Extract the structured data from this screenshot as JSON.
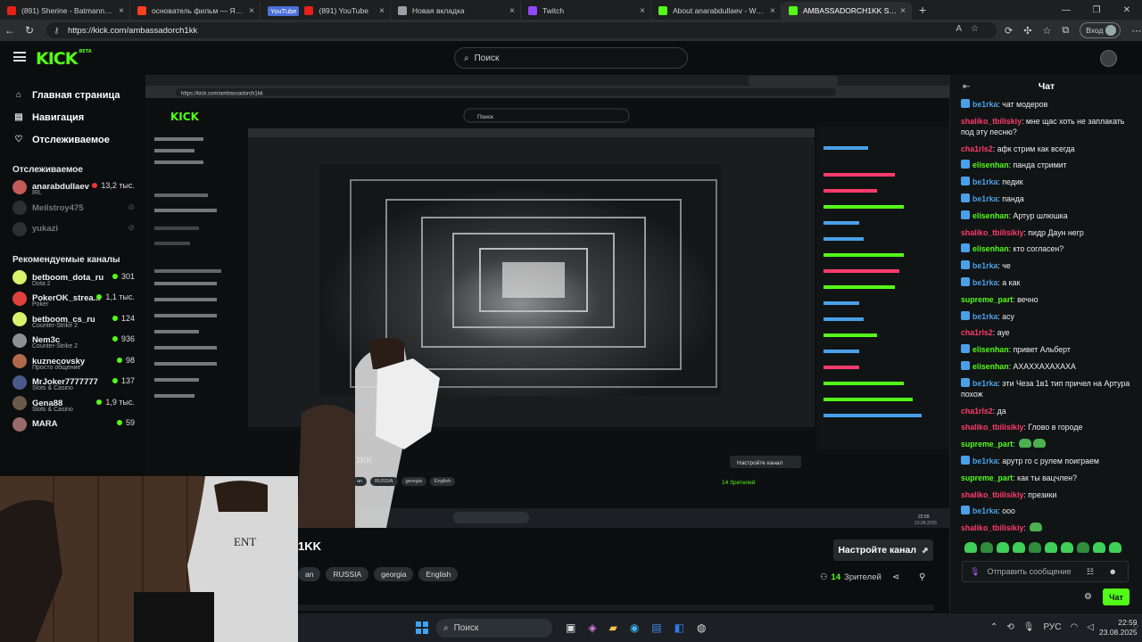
{
  "browser": {
    "tabs": [
      {
        "label": "(891) Sherine - Batmanna Ansak",
        "icon": "youtube-icon",
        "color": "#e62117"
      },
      {
        "label": "основатель фильм — Яндекс: на",
        "icon": "yandex-icon",
        "color": "#fc3f1d"
      },
      {
        "label": "(891) YouTube",
        "icon": "youtube-icon",
        "color": "#e62117",
        "badge": "YouTube"
      },
      {
        "label": "Новая вкладка",
        "icon": "newtab-icon",
        "color": "#9aa0a6"
      },
      {
        "label": "Twitch",
        "icon": "twitch-icon",
        "color": "#9146ff"
      },
      {
        "label": "About anarabdullaev - Watch Liv",
        "icon": "kick-icon",
        "color": "#53fc18"
      },
      {
        "label": "AMBASSADORCH1KK Stream - W",
        "icon": "kick-icon",
        "color": "#53fc18",
        "active": true
      }
    ],
    "url": "https://kick.com/ambassadorch1kk",
    "login_label": "Вход"
  },
  "kick": {
    "logo": "KICK",
    "logo_beta": "BETA",
    "search_placeholder": "Поиск"
  },
  "sidebar": {
    "nav": [
      {
        "label": "Главная страница",
        "icon": "home-icon"
      },
      {
        "label": "Навигация",
        "icon": "compass-icon"
      },
      {
        "label": "Отслеживаемое",
        "icon": "heart-icon"
      }
    ],
    "following_title": "Отслеживаемое",
    "following": [
      {
        "name": "anarabdullaev",
        "category": "IRL",
        "viewers": "13,2 тыс.",
        "live": true,
        "color": "#c45a5a"
      },
      {
        "name": "Meilstroy475",
        "category": "",
        "viewers": "",
        "live": false
      },
      {
        "name": "yukazi",
        "category": "",
        "viewers": "",
        "live": false
      }
    ],
    "recommended_title": "Рекомендуемые каналы",
    "recommended": [
      {
        "name": "betboom_dota_ru",
        "category": "Dota 2",
        "viewers": "301",
        "color": "#d9f26b"
      },
      {
        "name": "PokerOK_strea...",
        "category": "Poker",
        "viewers": "1,1 тыс.",
        "color": "#e0413b"
      },
      {
        "name": "betboom_cs_ru",
        "category": "Counter-Strike 2",
        "viewers": "124",
        "color": "#d9f26b"
      },
      {
        "name": "Nem3c",
        "category": "Counter-Strike 2",
        "viewers": "936",
        "color": "#8f8f8f"
      },
      {
        "name": "kuznecovsky",
        "category": "Просто общение",
        "viewers": "98",
        "color": "#b06a4a"
      },
      {
        "name": "MrJoker7777777",
        "category": "Slots & Casino",
        "viewers": "137",
        "color": "#4a5a8a"
      },
      {
        "name": "Gena88",
        "category": "Slots & Casino",
        "viewers": "1,9 тыс.",
        "color": "#6a5a4a"
      },
      {
        "name": "MARA",
        "category": "",
        "viewers": "59",
        "color": "#9a6a6a"
      }
    ]
  },
  "stream": {
    "channel_title": "1KK",
    "tags": [
      "an",
      "RUSSIA",
      "georgia",
      "English"
    ],
    "setup_button": "Настройте канал",
    "viewers_count": "14",
    "viewers_label": "Зрителей",
    "inner_channel_title": "1KK",
    "inner_tags": [
      "an",
      "RUSSIA",
      "georgia",
      "English"
    ],
    "inner_setup_button": "Настройте канал",
    "inner_viewers": "14 Зрителей",
    "inner_search": "Поиск",
    "inner_time": "22:59",
    "inner_date": "23.08.2025"
  },
  "chat": {
    "title": "Чат",
    "messages": [
      {
        "user": "be1rka",
        "text": "чат модеров",
        "color": "#4aa0e8",
        "icon": true
      },
      {
        "user": "shaliko_tbiliskiy",
        "text": "мне щас хоть не заплакать под эту песню?",
        "color": "#ff3b6b"
      },
      {
        "user": "cha1rls2",
        "text": "афк стрим как всегда",
        "color": "#ff3b6b"
      },
      {
        "user": "elisenhan",
        "text": "панда стримит",
        "color": "#53fc18",
        "icon": true
      },
      {
        "user": "be1rka",
        "text": "педик",
        "color": "#4aa0e8",
        "icon": true
      },
      {
        "user": "be1rka",
        "text": "панда",
        "color": "#4aa0e8",
        "icon": true
      },
      {
        "user": "elisenhan",
        "text": "Артур шлюшка",
        "color": "#53fc18",
        "icon": true
      },
      {
        "user": "shaliko_tbilisikiy",
        "text": "пидр Даун негр",
        "color": "#ff3b6b"
      },
      {
        "user": "elisenhan",
        "text": "кто согласен?",
        "color": "#53fc18",
        "icon": true
      },
      {
        "user": "be1rka",
        "text": "че",
        "color": "#4aa0e8",
        "icon": true
      },
      {
        "user": "be1rka",
        "text": "а как",
        "color": "#4aa0e8",
        "icon": true
      },
      {
        "user": "supreme_part",
        "text": "вечно",
        "color": "#53fc18"
      },
      {
        "user": "be1rka",
        "text": "асу",
        "color": "#4aa0e8",
        "icon": true
      },
      {
        "user": "cha1rls2",
        "text": "ауе",
        "color": "#ff3b6b"
      },
      {
        "user": "elisenhan",
        "text": "привет Альберт",
        "color": "#53fc18",
        "icon": true
      },
      {
        "user": "elisenhan",
        "text": "АХАХХАХАХАХА",
        "color": "#53fc18",
        "icon": true
      },
      {
        "user": "be1rka",
        "text": "эти Чеза 1в1 тип причел на Артура похож",
        "color": "#4aa0e8",
        "icon": true
      },
      {
        "user": "cha1rls2",
        "text": "да",
        "color": "#ff3b6b"
      },
      {
        "user": "shaliko_tbilisikiy",
        "text": "Гловo в городе",
        "color": "#ff3b6b"
      },
      {
        "user": "supreme_part",
        "text": "",
        "color": "#53fc18",
        "emotes": 2
      },
      {
        "user": "be1rka",
        "text": "арутр го с рулем поиграем",
        "color": "#4aa0e8",
        "icon": true
      },
      {
        "user": "supreme_part",
        "text": "как ты вацчлен?",
        "color": "#53fc18"
      },
      {
        "user": "shaliko_tbilisikiy",
        "text": "презики",
        "color": "#ff3b6b"
      },
      {
        "user": "be1rka",
        "text": "ооо",
        "color": "#4aa0e8",
        "icon": true
      },
      {
        "user": "shaliko_tbilisikiy",
        "text": "",
        "color": "#ff3b6b",
        "emotes": 1
      }
    ],
    "input_placeholder": "Отправить сообщение",
    "send_label": "Чат"
  },
  "taskbar": {
    "search_placeholder": "Поиск",
    "lang": "РУС",
    "time": "22:59",
    "date": "23.08.2025"
  }
}
